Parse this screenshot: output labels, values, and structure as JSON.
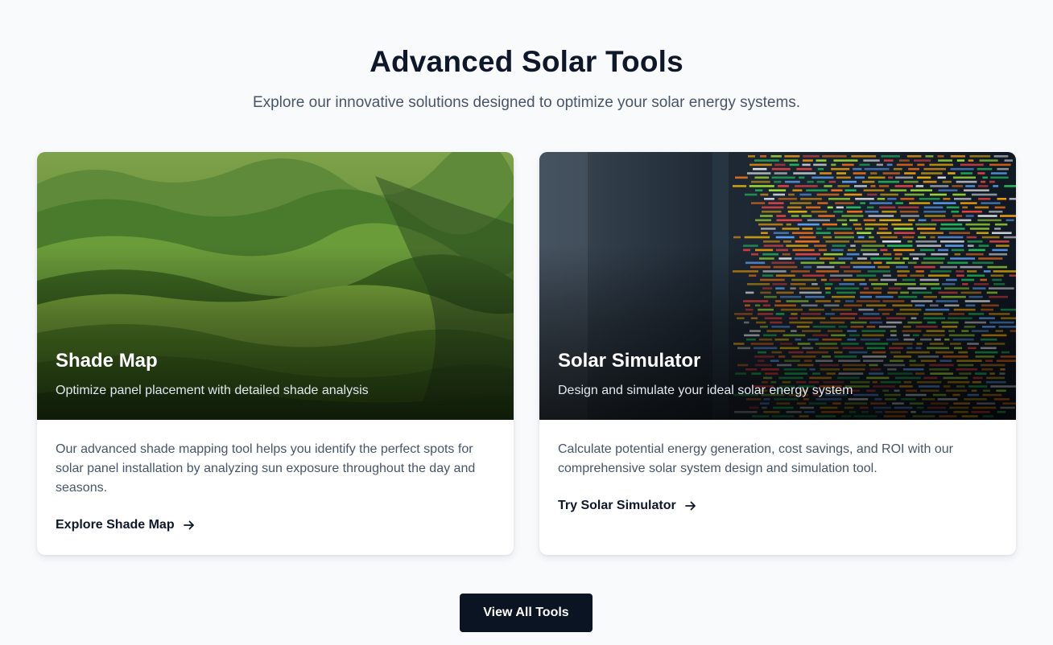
{
  "section": {
    "title": "Advanced Solar Tools",
    "subtitle": "Explore our innovative solutions designed to optimize your solar energy systems."
  },
  "cards": [
    {
      "image": "green-hills-landscape",
      "title": "Shade Map",
      "subtitle": "Optimize panel placement with detailed shade analysis",
      "description": "Our advanced shade mapping tool helps you identify the perfect spots for solar panel installation by analyzing sun exposure throughout the day and seasons.",
      "link_label": "Explore Shade Map",
      "link_icon": "arrow-right-icon"
    },
    {
      "image": "code-on-screen",
      "title": "Solar Simulator",
      "subtitle": "Design and simulate your ideal solar energy system",
      "description": "Calculate potential energy generation, cost savings, and ROI with our comprehensive solar system design and simulation tool.",
      "link_label": "Try Solar Simulator",
      "link_icon": "arrow-right-icon"
    }
  ],
  "view_all_label": "View All Tools",
  "colors": {
    "background": "#f8fafc",
    "heading": "#0f172a",
    "body_text": "#475569",
    "button_bg": "#0b1422"
  }
}
